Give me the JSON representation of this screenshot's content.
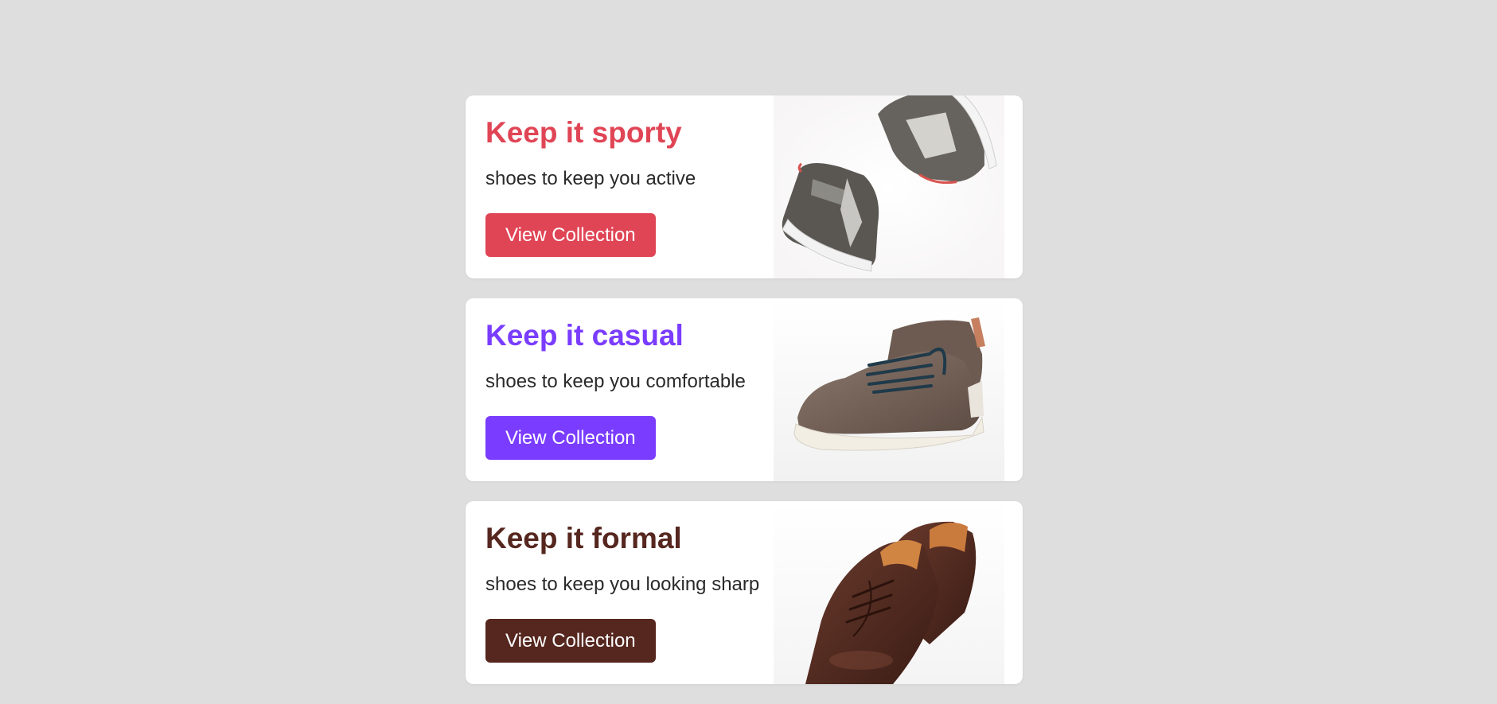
{
  "cards": [
    {
      "title": "Keep it sporty",
      "subtitle": "shoes to keep you active",
      "button_label": "View Collection",
      "accent": "#e04555",
      "image": "sneakers-image"
    },
    {
      "title": "Keep it casual",
      "subtitle": "shoes to keep you comfortable",
      "button_label": "View Collection",
      "accent": "#7a3cff",
      "image": "casual-shoe-image"
    },
    {
      "title": "Keep it formal",
      "subtitle": "shoes to keep you looking sharp",
      "button_label": "View Collection",
      "accent": "#56271f",
      "image": "formal-shoes-image"
    }
  ]
}
